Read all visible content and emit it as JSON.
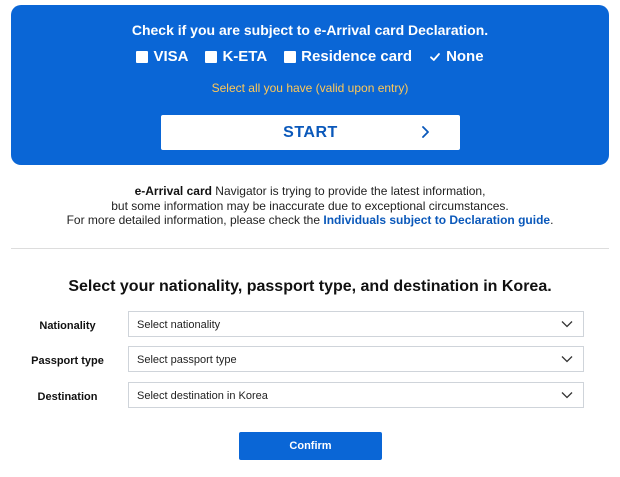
{
  "panel": {
    "title": "Check if you are subject to e-Arrival card Declaration.",
    "options": [
      {
        "label": "VISA",
        "checked": false
      },
      {
        "label": "K-ETA",
        "checked": false
      },
      {
        "label": "Residence card",
        "checked": false
      },
      {
        "label": "None",
        "checked": true
      }
    ],
    "hint": "Select all you have (valid upon entry)",
    "start_label": "START",
    "start_icon": "chevron-right-icon"
  },
  "info": {
    "brand": "e-Arrival card",
    "line1_rest": " Navigator is trying to provide the latest information,",
    "line2": "but some information may be inaccurate due to exceptional circumstances.",
    "line3_prefix": "For more detailed information, please check the ",
    "guide_link": "Individuals subject to Declaration guide",
    "line3_suffix": "."
  },
  "form": {
    "title": "Select your nationality, passport type, and destination in Korea.",
    "fields": [
      {
        "label": "Nationality",
        "placeholder": "Select nationality"
      },
      {
        "label": "Passport type",
        "placeholder": "Select passport type"
      },
      {
        "label": "Destination",
        "placeholder": "Select destination in Korea"
      }
    ],
    "confirm_label": "Confirm"
  },
  "colors": {
    "primary": "#0a66d6",
    "link": "#0a58ba",
    "hint": "#ffc857"
  }
}
